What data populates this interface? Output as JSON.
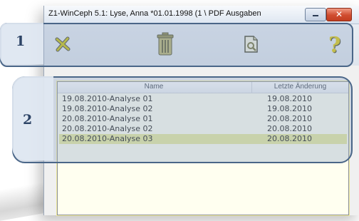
{
  "window": {
    "title": "Z1-WinCeph 5.1: Lyse, Anna *01.01.1998 (1 \\ PDF Ausgaben",
    "close_glyph": "✕"
  },
  "toolbar": {
    "buttons": [
      {
        "icon": "close-x-icon",
        "color": "#b9b400"
      },
      {
        "icon": "trash-icon",
        "color": "#9a9a3a"
      },
      {
        "icon": "document-search-icon",
        "color": "#6f6f35"
      },
      {
        "icon": "help-question-icon",
        "color": "#d9c300"
      }
    ]
  },
  "list": {
    "columns": {
      "name": "Name",
      "date": "Letzte Änderung"
    },
    "rows": [
      {
        "name": "19.08.2010-Analyse 01",
        "date": "19.08.2010",
        "selected": false
      },
      {
        "name": "19.08.2010-Analyse 02",
        "date": "19.08.2010",
        "selected": false
      },
      {
        "name": "20.08.2010-Analyse 01",
        "date": "20.08.2010",
        "selected": false
      },
      {
        "name": "20.08.2010-Analyse 02",
        "date": "20.08.2010",
        "selected": false
      },
      {
        "name": "20.08.2010-Analyse 03",
        "date": "20.08.2010",
        "selected": true
      }
    ]
  },
  "callouts": {
    "one": "1",
    "two": "2"
  }
}
